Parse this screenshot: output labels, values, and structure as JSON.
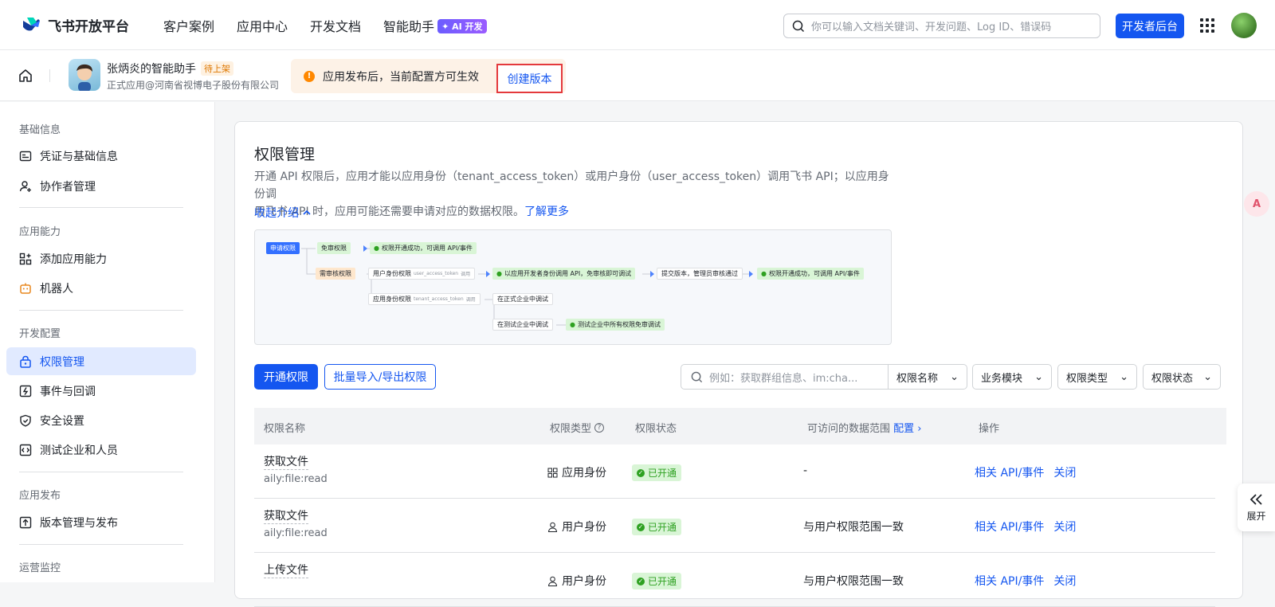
{
  "brand": {
    "name": "飞书开放平台"
  },
  "nav": [
    {
      "label": "客户案例"
    },
    {
      "label": "应用中心"
    },
    {
      "label": "开发文档"
    },
    {
      "label": "智能助手",
      "badge": "AI 开发"
    }
  ],
  "search": {
    "placeholder": "你可以输入文档关键词、开发问题、Log ID、错误码"
  },
  "header": {
    "dev_console": "开发者后台"
  },
  "app": {
    "name": "张炳炎的智能助手",
    "status": "待上架",
    "org": "正式应用@河南省视博电子股份有限公司"
  },
  "notice": {
    "text": "应用发布后，当前配置方可生效",
    "action": "创建版本"
  },
  "sidebar": {
    "sections": [
      {
        "title": "基础信息",
        "items": [
          {
            "label": "凭证与基础信息",
            "icon": "credential-icon"
          },
          {
            "label": "协作者管理",
            "icon": "user-add-icon"
          }
        ]
      },
      {
        "title": "应用能力",
        "items": [
          {
            "label": "添加应用能力",
            "icon": "apps-add-icon"
          },
          {
            "label": "机器人",
            "icon": "robot-icon"
          }
        ]
      },
      {
        "title": "开发配置",
        "items": [
          {
            "label": "权限管理",
            "icon": "lock-icon"
          },
          {
            "label": "事件与回调",
            "icon": "event-icon"
          },
          {
            "label": "安全设置",
            "icon": "shield-icon"
          },
          {
            "label": "测试企业和人员",
            "icon": "code-icon"
          }
        ]
      },
      {
        "title": "应用发布",
        "items": [
          {
            "label": "版本管理与发布",
            "icon": "upload-icon"
          }
        ]
      },
      {
        "title": "运营监控",
        "items": []
      }
    ]
  },
  "main": {
    "title": "权限管理",
    "desc_line1": "开通 API 权限后，应用才能以应用身份（tenant_access_token）或用户身份（user_access_token）调用飞书 API；以应用身份调",
    "desc_line2": "用飞书 API 时，应用可能还需要申请对应的数据权限。",
    "learn_more": "了解更多",
    "collapse": "收起介绍",
    "flow": {
      "apply": "申请权限",
      "exempt": "免审权限",
      "success1": "权限开通成功，可调用 API/事件",
      "review": "需审核权限",
      "user_identity": "用户身份权限",
      "user_token": "user_access_token",
      "call": "调用",
      "dev_identity": "以应用开发者身份调用 API，免审核即可调试",
      "submit": "提交版本，管理员审核通过",
      "success2": "权限开通成功，可调用 API/事件",
      "app_identity": "应用身份权限",
      "tenant_token": "tenant_access_token",
      "formal_debug": "在正式企业中调试",
      "test_debug": "在测试企业中调试",
      "test_exempt": "测试企业中所有权限免审调试"
    },
    "buttons": {
      "enable": "开通权限",
      "batch": "批量导入/导出权限"
    },
    "filters": {
      "search_placeholder": "例如：获取群组信息、im:cha...",
      "name": "权限名称",
      "module": "业务模块",
      "type": "权限类型",
      "status": "权限状态"
    },
    "table": {
      "headers": {
        "name": "权限名称",
        "type": "权限类型",
        "status": "权限状态",
        "scope": "可访问的数据范围",
        "scope_config": "配置",
        "ops": "操作"
      },
      "rows": [
        {
          "name": "获取文件",
          "code": "aily:file:read",
          "type": "应用身份",
          "type_icon": "apps-icon",
          "status": "已开通",
          "scope": "-",
          "op1": "相关 API/事件",
          "op2": "关闭"
        },
        {
          "name": "获取文件",
          "code": "aily:file:read",
          "type": "用户身份",
          "type_icon": "user-icon",
          "status": "已开通",
          "scope": "与用户权限范围一致",
          "op1": "相关 API/事件",
          "op2": "关闭"
        },
        {
          "name": "上传文件",
          "code": "",
          "type": "用户身份",
          "type_icon": "user-icon",
          "status": "已开通",
          "scope": "与用户权限范围一致",
          "op1": "相关 API/事件",
          "op2": "关闭"
        }
      ]
    }
  },
  "expand": {
    "label": "展开"
  }
}
